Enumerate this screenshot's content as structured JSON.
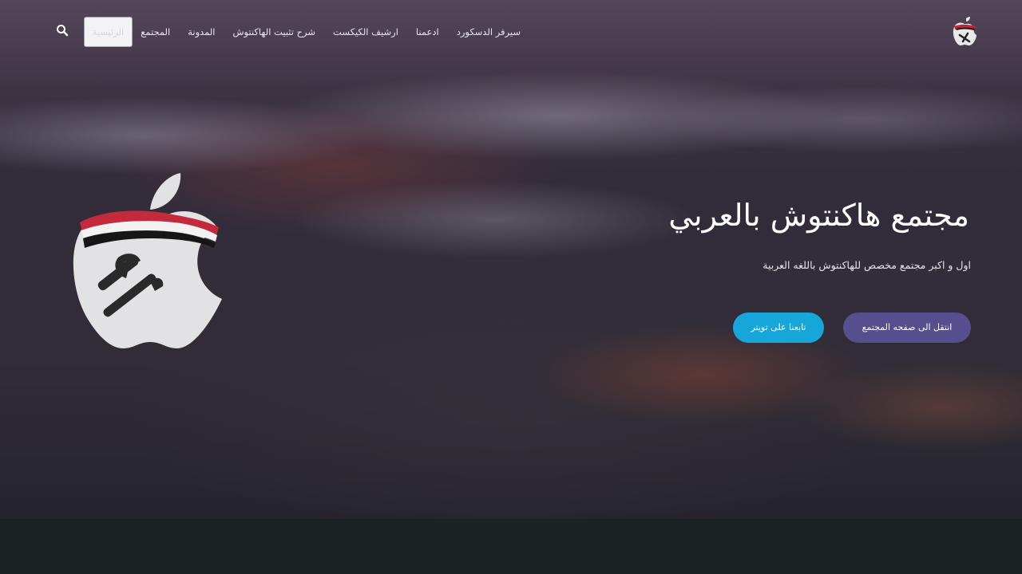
{
  "nav": {
    "items": [
      {
        "label": "الرئيسية",
        "active": true
      },
      {
        "label": "المجتمع"
      },
      {
        "label": "المدونة"
      },
      {
        "label": "شرح تثبيت الهاكنتوش"
      },
      {
        "label": "ارشيف الكيكست"
      },
      {
        "label": "ادعمنا"
      },
      {
        "label": "سيرفر الدسكورد"
      }
    ],
    "search_icon": "search-icon",
    "logo_icon": "apple-hackintosh-logo"
  },
  "hero": {
    "title": "مجتمع هاكنتوش بالعربي",
    "subtitle": "اول و اكبر مجتمع مخصص للهاكنتوش باللغه العربية",
    "buttons": {
      "community": "انتقل الى صفحه المجتمع",
      "twitter": "تابعنا على تويتر"
    },
    "logo_icon": "apple-with-tools-logo"
  },
  "colors": {
    "community_button": "#574e8e",
    "twitter_button": "#16a6da",
    "footer": "#1c2124"
  }
}
